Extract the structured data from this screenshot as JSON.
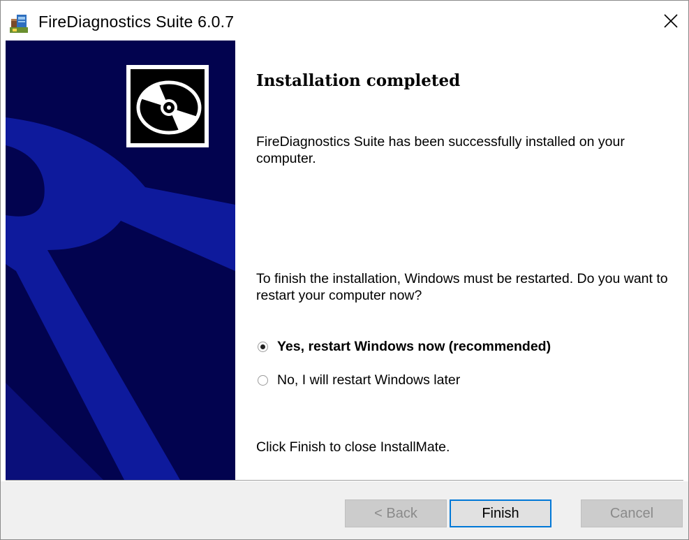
{
  "window": {
    "title": "FireDiagnostics Suite  6.0.7",
    "close_symbol": "✕"
  },
  "icons": {
    "app": "installer-package-icon",
    "close": "close-icon",
    "logo": "disc-logo-icon"
  },
  "content": {
    "heading": "Installation completed",
    "success_message": "FireDiagnostics Suite has been successfully installed on your computer.",
    "restart_prompt": "To finish the installation, Windows must be restarted. Do you want to restart your computer now?",
    "options": [
      {
        "label": "Yes, restart Windows now (recommended)",
        "selected": true
      },
      {
        "label": "No, I will restart Windows later",
        "selected": false
      }
    ],
    "finish_hint": "Click Finish to close InstallMate."
  },
  "buttons": {
    "back": "< Back",
    "finish": "Finish",
    "cancel": "Cancel"
  },
  "colors": {
    "banner_dark": "#02034f",
    "banner_shape": "#0e1a9c",
    "focus_border": "#0078d7"
  }
}
